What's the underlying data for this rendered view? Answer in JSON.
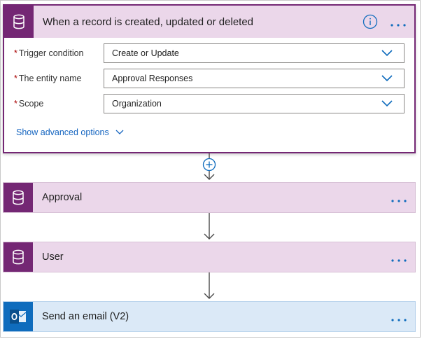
{
  "trigger": {
    "title": "When a record is created, updated or deleted",
    "icon": "database-icon",
    "info_icon": "info-icon",
    "fields": [
      {
        "required_mark": "*",
        "label": "Trigger condition",
        "value": "Create or Update"
      },
      {
        "required_mark": "*",
        "label": "The entity name",
        "value": "Approval Responses"
      },
      {
        "required_mark": "*",
        "label": "Scope",
        "value": "Organization"
      }
    ],
    "advanced_link": "Show advanced options"
  },
  "actions": [
    {
      "title": "Approval",
      "icon": "database-icon",
      "color": "#742774"
    },
    {
      "title": "User",
      "icon": "database-icon",
      "color": "#742774"
    },
    {
      "title": "Send an email (V2)",
      "icon": "outlook-icon",
      "color": "#0f6cbd"
    }
  ],
  "colors": {
    "accent_purple": "#742774",
    "header_purple_bg": "#ebd7ea",
    "header_blue_bg": "#dbe9f7",
    "outlook_blue": "#0f6cbd",
    "link_blue": "#1565c0",
    "required_red": "#a80000"
  }
}
